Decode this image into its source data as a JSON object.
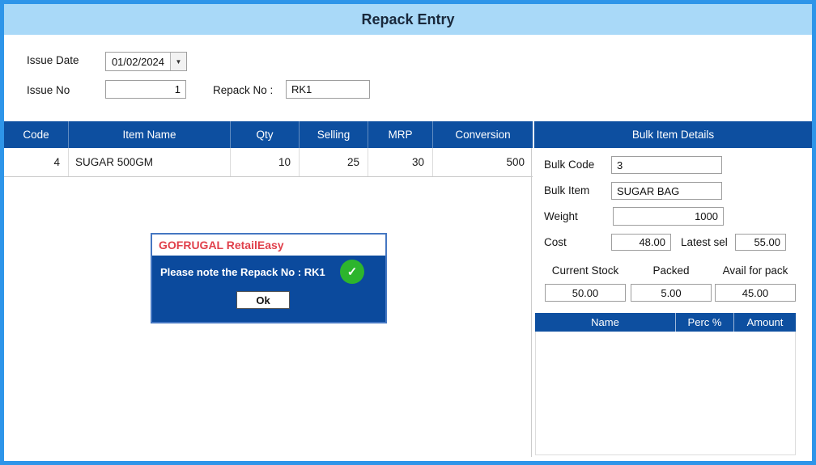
{
  "header": {
    "title": "Repack Entry"
  },
  "form": {
    "issue_date_label": "Issue Date",
    "issue_date_value": "01/02/2024",
    "issue_no_label": "Issue No",
    "issue_no_value": "1",
    "repack_no_label": "Repack No :",
    "repack_no_value": "RK1"
  },
  "icons": {
    "dropdown": "▼",
    "check": "✓"
  },
  "items_table": {
    "columns": [
      "Code",
      "Item Name",
      "Qty",
      "Selling",
      "MRP",
      "Conversion"
    ],
    "rows": [
      {
        "code": "4",
        "item_name": "SUGAR 500GM",
        "qty": "10",
        "selling": "25",
        "mrp": "30",
        "conversion": "500"
      }
    ]
  },
  "bulk_panel": {
    "title": "Bulk Item Details",
    "bulk_code_label": "Bulk Code",
    "bulk_code_value": "3",
    "bulk_item_label": "Bulk Item",
    "bulk_item_value": "SUGAR BAG",
    "weight_label": "Weight",
    "weight_value": "1000",
    "cost_label": "Cost",
    "cost_value": "48.00",
    "latest_sel_label": "Latest sel",
    "latest_sel_value": "55.00",
    "current_stock_label": "Current Stock",
    "current_stock_value": "50.00",
    "packed_label": "Packed",
    "packed_value": "5.00",
    "avail_label": "Avail for pack",
    "avail_value": "45.00",
    "breakup_table": {
      "columns": [
        "Name",
        "Perc %",
        "Amount"
      ]
    }
  },
  "dialog": {
    "title": "GOFRUGAL RetailEasy",
    "message": "Please note the Repack No : RK1",
    "ok_label": "Ok"
  },
  "colors": {
    "outer_border": "#2e95e9",
    "titlebar_bg": "#a9d9f8",
    "header_blue": "#0d4fa0",
    "dialog_blue": "#0b4a9d",
    "dialog_title_red": "#e0404b",
    "success_green": "#2db52d"
  }
}
